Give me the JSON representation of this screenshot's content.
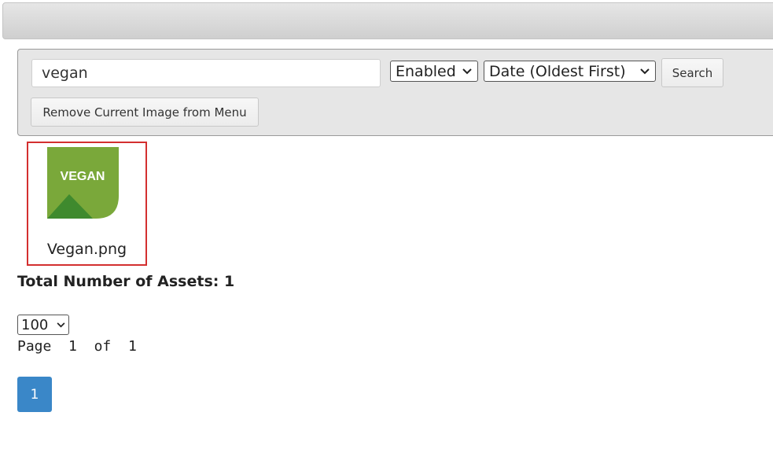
{
  "search": {
    "value": "vegan",
    "status_selected": "Enabled",
    "sort_selected": "Date (Oldest First)",
    "search_label": "Search",
    "remove_label": "Remove Current Image from Menu"
  },
  "assets": [
    {
      "thumb_text": "VEGAN",
      "filename": "Vegan.png"
    }
  ],
  "summary": {
    "total_label": "Total Number of Assets: 1"
  },
  "pagination": {
    "page_size": "100",
    "page_word": "Page",
    "current_page": "1",
    "of_word": "of",
    "total_pages": "1",
    "page_button": "1"
  },
  "colors": {
    "accent": "#3a87c8",
    "selection_border": "#d32f2f",
    "vegan_green_light": "#7aa83a",
    "vegan_green_dark": "#3f8a2e"
  }
}
